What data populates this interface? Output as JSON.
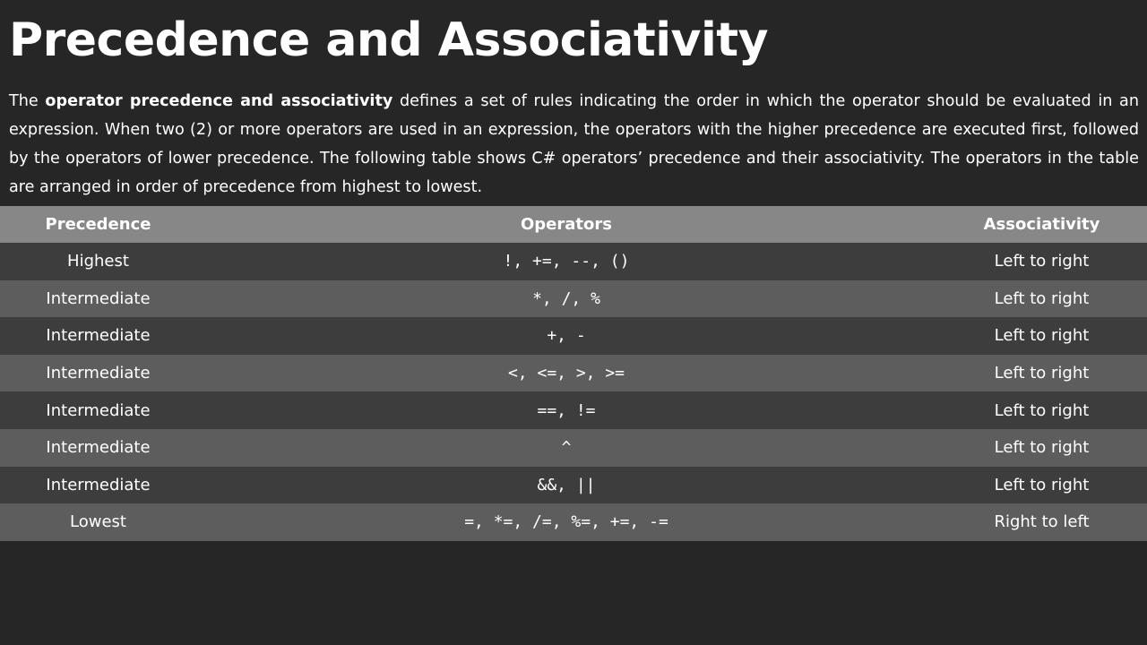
{
  "title": "Precedence and Associativity",
  "intro": {
    "before": "The ",
    "bold": "operator precedence and associativity",
    "after": " defines a set of rules indicating the order in which the operator should be evaluated in an expression. When two (2) or more operators are used in an expression, the operators with the higher precedence are executed first, followed by the operators of lower precedence. The following table shows C# operators’ precedence and their associativity. The operators in the table are arranged in order of precedence from highest to lowest."
  },
  "table": {
    "headers": [
      "Precedence",
      "Operators",
      "Associativity"
    ],
    "rows": [
      {
        "precedence": "Highest",
        "operators": "!, +=, --, ()",
        "associativity": "Left to right"
      },
      {
        "precedence": "Intermediate",
        "operators": "*, /, %",
        "associativity": "Left to right"
      },
      {
        "precedence": "Intermediate",
        "operators": "+, -",
        "associativity": "Left to right"
      },
      {
        "precedence": "Intermediate",
        "operators": "<, <=, >, >=",
        "associativity": "Left to right"
      },
      {
        "precedence": "Intermediate",
        "operators": "==, !=",
        "associativity": "Left to right"
      },
      {
        "precedence": "Intermediate",
        "operators": "^",
        "associativity": "Left to right"
      },
      {
        "precedence": "Intermediate",
        "operators": "&&, ||",
        "associativity": "Left to right"
      },
      {
        "precedence": "Lowest",
        "operators": "=, *=, /=, %=, +=, -=",
        "associativity": "Right to left"
      }
    ]
  }
}
